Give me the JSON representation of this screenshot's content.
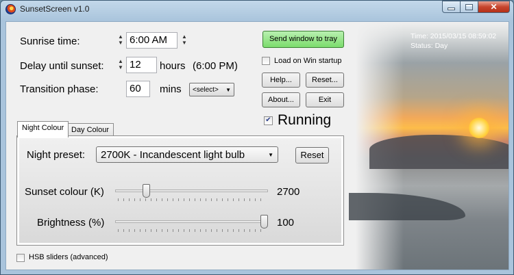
{
  "window": {
    "title": "SunsetScreen v1.0"
  },
  "status": {
    "time": "Time: 2015/03/15 08:59:02",
    "state": "Status: Day"
  },
  "sunrise": {
    "label": "Sunrise time:",
    "value": "6:00 AM"
  },
  "delay": {
    "label": "Delay until sunset:",
    "value": "12",
    "unit": "hours",
    "computed": "(6:00 PM)"
  },
  "transition": {
    "label": "Transition phase:",
    "value": "60",
    "unit": "mins",
    "select": "<select>"
  },
  "buttons": {
    "tray": "Send window to tray",
    "help": "Help...",
    "reset": "Reset...",
    "about": "About...",
    "exit": "Exit"
  },
  "startup": {
    "label": "Load on Win startup",
    "checked": false
  },
  "running": {
    "label": "Running",
    "checked": true
  },
  "tabs": [
    {
      "label": "Night Colour"
    },
    {
      "label": "Day Colour"
    }
  ],
  "night": {
    "preset_label": "Night preset:",
    "preset_value": "2700K - Incandescent light bulb",
    "reset": "Reset",
    "sunset_label": "Sunset colour (K)",
    "sunset_value": "2700",
    "sunset_fraction": 0.19,
    "brightness_label": "Brightness (%)",
    "brightness_value": "100",
    "brightness_fraction": 1.0
  },
  "hsb": {
    "label": "HSB sliders (advanced)",
    "checked": false
  },
  "icons": {
    "app": "sunset-app-icon",
    "minimize": "minimize-icon",
    "maximize": "maximize-icon",
    "close": "close-icon"
  },
  "colors": {
    "tray_button": "#7bdc6c",
    "close_button": "#c7452e"
  }
}
